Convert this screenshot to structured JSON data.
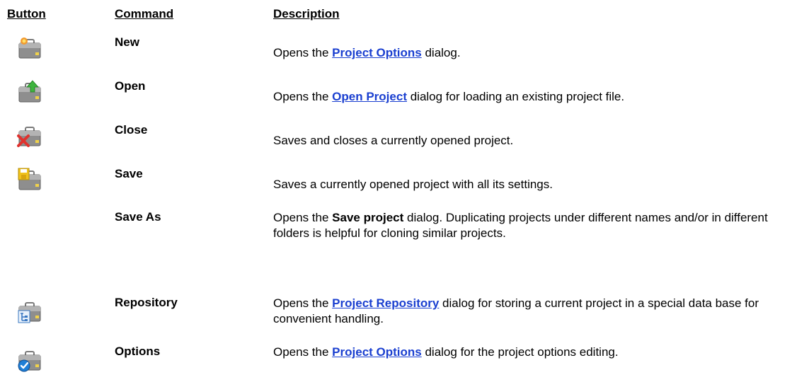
{
  "headers": {
    "button": "Button",
    "command": "Command",
    "description": "Description"
  },
  "rows": [
    {
      "command": "New",
      "icon": "briefcase-new-icon",
      "desc_pre": "Opens the ",
      "desc_link": "Project Options",
      "desc_post": " dialog."
    },
    {
      "command": "Open",
      "icon": "briefcase-open-icon",
      "desc_pre": "Opens the ",
      "desc_link": "Open Project",
      "desc_post": " dialog for loading an existing project file."
    },
    {
      "command": "Close",
      "icon": "briefcase-close-icon",
      "desc": "Saves and closes a currently opened project."
    },
    {
      "command": "Save",
      "icon": "briefcase-save-icon",
      "desc": "Saves a currently opened project with all its settings."
    },
    {
      "command": "Save As",
      "desc_pre": "Opens the ",
      "desc_bold": "Save project",
      "desc_post": " dialog. Duplicating projects under different names and/or in different folders is helpful for cloning similar projects."
    },
    {
      "command": "Repository",
      "icon": "briefcase-repository-icon",
      "desc_pre": "Opens the ",
      "desc_link": "Project Repository",
      "desc_post": " dialog for storing a current project in a special data base for convenient handling."
    },
    {
      "command": "Options",
      "icon": "briefcase-options-icon",
      "desc_pre": "Opens the ",
      "desc_link": "Project Options",
      "desc_post": " dialog for the project options editing."
    }
  ]
}
